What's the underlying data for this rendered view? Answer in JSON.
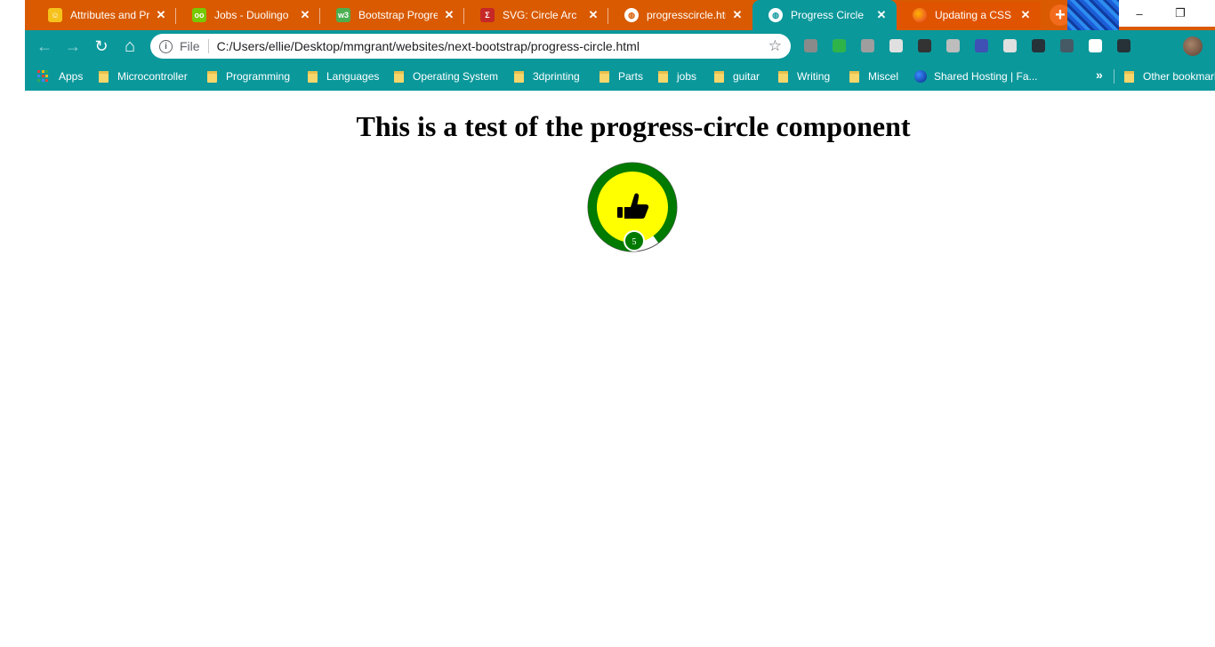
{
  "browser": {
    "tabs": [
      {
        "title": "Attributes and Pro",
        "favicon": "emoji-face-icon",
        "favicon_color": "#f6c21c",
        "active": false
      },
      {
        "title": "Jobs - Duolingo",
        "favicon": "duolingo-owl-icon",
        "favicon_color": "#78c800",
        "active": false
      },
      {
        "title": "Bootstrap Progress",
        "favicon": "w3-icon",
        "favicon_color": "#4caf50",
        "active": false
      },
      {
        "title": "SVG: Circle Arc",
        "favicon": "sigma-icon",
        "favicon_color": "#c62828",
        "active": false
      },
      {
        "title": "progresscircle.htm",
        "favicon": "globe-icon",
        "favicon_color": "#ffffff",
        "active": false
      },
      {
        "title": "Progress Circle",
        "favicon": "globe-icon",
        "favicon_color": "#ffffff",
        "active": true
      },
      {
        "title": "Updating a CSS Va",
        "favicon": "firefox-orb-icon",
        "favicon_color": "#ff5a1f",
        "active": false
      }
    ],
    "new_tab_label": "+",
    "window_controls": {
      "minimize": "–",
      "restore": "❐"
    },
    "address_bar": {
      "scheme_label": "File",
      "url": "C:/Users/ellie/Desktop/mmgrant/websites/next-bootstrap/progress-circle.html"
    },
    "nav_icons": {
      "back": "←",
      "forward": "→",
      "reload": "↻",
      "home": "⌂",
      "info": "i",
      "star": "☆"
    },
    "extensions": [
      {
        "name": "ext-icon-1",
        "color": "#8a8a8a"
      },
      {
        "name": "ext-icon-2",
        "color": "#2fb44a"
      },
      {
        "name": "ext-icon-3",
        "color": "#9e9e9e"
      },
      {
        "name": "ext-icon-4",
        "color": "#e0e0e0"
      },
      {
        "name": "ext-icon-5",
        "color": "#333333"
      },
      {
        "name": "ext-icon-6",
        "color": "#bdbdbd"
      },
      {
        "name": "ext-icon-7",
        "color": "#3f51b5"
      },
      {
        "name": "ext-icon-8",
        "color": "#e0e0e0"
      },
      {
        "name": "ext-icon-9",
        "color": "#263238"
      },
      {
        "name": "ext-icon-10",
        "color": "#455a64"
      },
      {
        "name": "ext-icon-11",
        "color": "#ffffff"
      },
      {
        "name": "ext-icon-12",
        "color": "#263238"
      }
    ],
    "bookmarks": [
      {
        "label": "Apps",
        "type": "apps"
      },
      {
        "label": "Microcontroller",
        "type": "folder"
      },
      {
        "label": "Programming",
        "type": "folder"
      },
      {
        "label": "Languages",
        "type": "folder"
      },
      {
        "label": "Operating System",
        "type": "folder"
      },
      {
        "label": "3dprinting",
        "type": "folder"
      },
      {
        "label": "Parts",
        "type": "folder"
      },
      {
        "label": "jobs",
        "type": "folder"
      },
      {
        "label": "guitar",
        "type": "folder"
      },
      {
        "label": "Writing",
        "type": "folder"
      },
      {
        "label": "Miscel",
        "type": "folder"
      },
      {
        "label": "Shared Hosting | Fa...",
        "type": "site"
      }
    ],
    "bookmarks_overflow": "»",
    "other_bookmarks": "Other bookmarks"
  },
  "page": {
    "heading": "This is a test of the progress-circle component",
    "progress_circle": {
      "progress_fraction": 0.9,
      "badge_value": "5",
      "icon": "thumbs-up-icon",
      "colors": {
        "ring": "#007a00",
        "fill": "#ffff00",
        "track": "#ffffff",
        "badge": "#007a00",
        "icon": "#000000"
      }
    }
  }
}
